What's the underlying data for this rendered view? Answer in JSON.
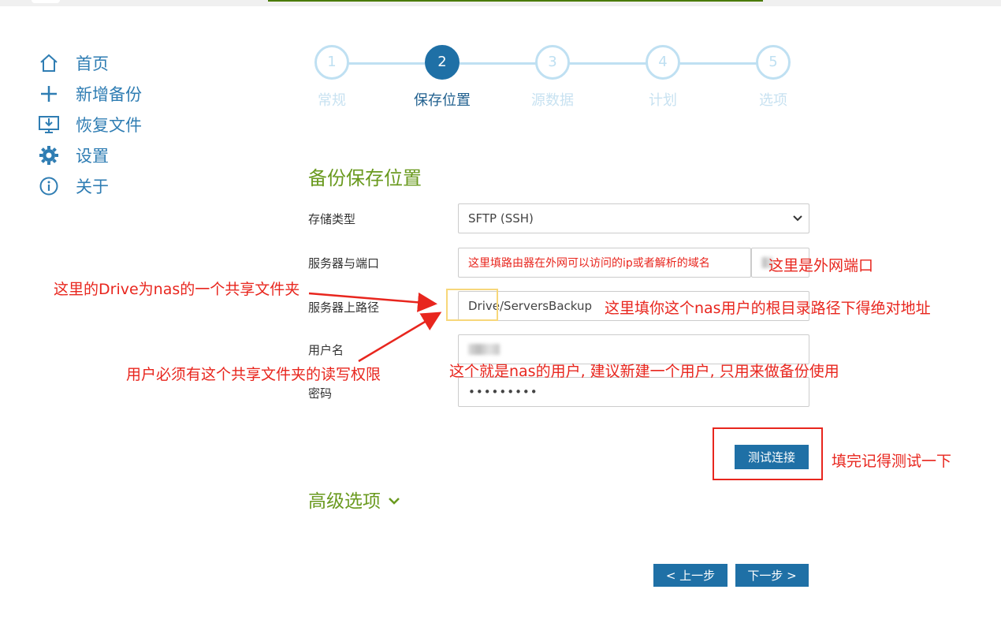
{
  "colors": {
    "accent": "#1f70a6",
    "nav_text": "#2f7db3",
    "section_title": "#6a9a1f",
    "annotation": "#e8261e",
    "step_inactive": "#bfe0f2"
  },
  "sidebar": {
    "items": [
      {
        "label": "首页",
        "icon": "home-icon"
      },
      {
        "label": "新增备份",
        "icon": "plus-icon"
      },
      {
        "label": "恢复文件",
        "icon": "monitor-download-icon"
      },
      {
        "label": "设置",
        "icon": "gear-icon"
      },
      {
        "label": "关于",
        "icon": "info-icon"
      }
    ]
  },
  "stepper": {
    "current_step": 2,
    "steps": [
      {
        "num": "1",
        "label": "常规"
      },
      {
        "num": "2",
        "label": "保存位置"
      },
      {
        "num": "3",
        "label": "源数据"
      },
      {
        "num": "4",
        "label": "计划"
      },
      {
        "num": "5",
        "label": "选项"
      }
    ]
  },
  "form": {
    "title": "备份保存位置",
    "storage_type": {
      "label": "存储类型",
      "value": "SFTP (SSH)"
    },
    "server_port": {
      "label": "服务器与端口",
      "value": "这里填路由器在外网可以访问的ip或者解析的域名"
    },
    "server_path": {
      "label": "服务器上路径",
      "value": "Drive/ServersBackup"
    },
    "username": {
      "label": "用户名"
    },
    "password": {
      "label": "密码",
      "value": "•••••••••"
    },
    "test_button": "测试连接",
    "advanced": "高级选项"
  },
  "nav_buttons": {
    "prev": "< 上一步",
    "next": "下一步 >"
  },
  "annotations": {
    "port_note": "这里是外网端口",
    "drive_note": "这里的Drive为nas的一个共享文件夹",
    "path_note": "这里填你这个nas用户的根目录路径下得绝对地址",
    "permission_note": "用户必须有这个共享文件夹的读写权限",
    "user_note": "这个就是nas的用户, 建议新建一个用户, 只用来做备份使用",
    "test_note": "填完记得测试一下"
  }
}
